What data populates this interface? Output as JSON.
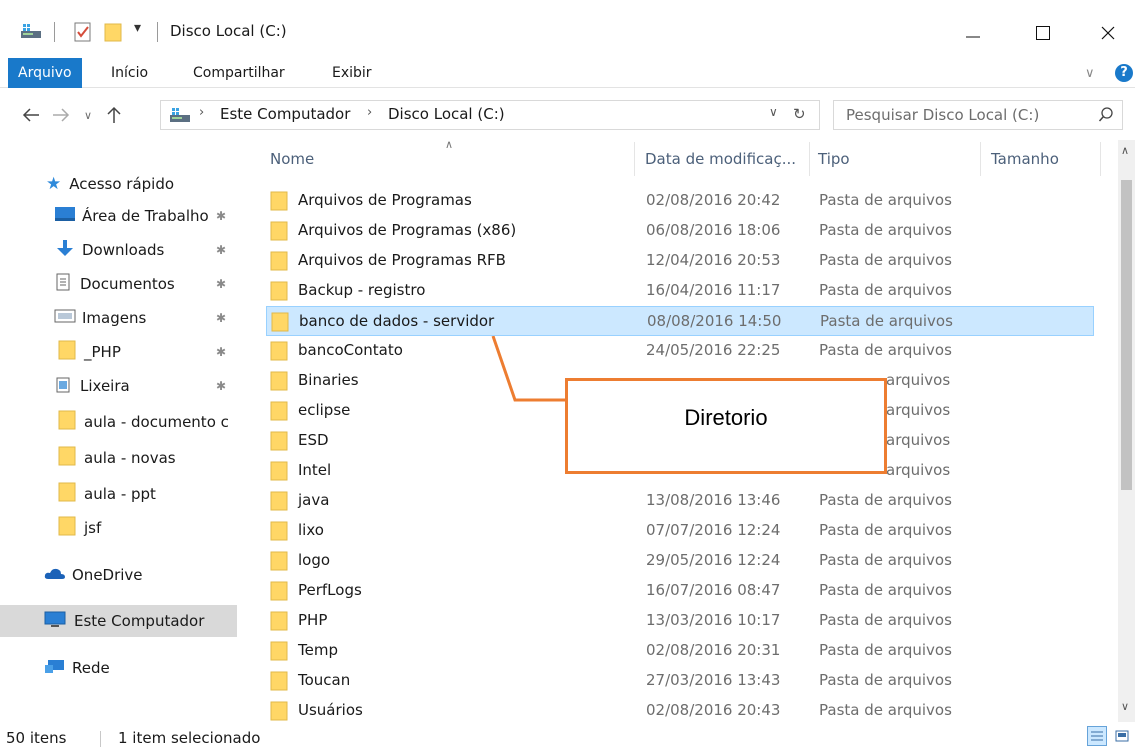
{
  "titlebar": {
    "title": "Disco Local (C:)",
    "icons": [
      "drive-icon",
      "properties-checkmark-icon",
      "new-folder-icon",
      "customize-dropdown-icon"
    ]
  },
  "ribbon": {
    "tabs": [
      {
        "label": "Arquivo",
        "active": true
      },
      {
        "label": "Início",
        "active": false
      },
      {
        "label": "Compartilhar",
        "active": false
      },
      {
        "label": "Exibir",
        "active": false
      }
    ]
  },
  "address": {
    "crumbs": [
      "Este Computador",
      "Disco Local (C:)"
    ],
    "search_placeholder": "Pesquisar Disco Local (C:)"
  },
  "sidebar": {
    "quick_access": "Acesso rápido",
    "pinned": [
      {
        "label": "Área de Trabalho",
        "icon": "desktop-icon",
        "pinned": true
      },
      {
        "label": "Downloads",
        "icon": "downloads-icon",
        "pinned": true
      },
      {
        "label": "Documentos",
        "icon": "documents-icon",
        "pinned": true
      },
      {
        "label": "Imagens",
        "icon": "pictures-icon",
        "pinned": true
      },
      {
        "label": "_PHP",
        "icon": "folder-icon",
        "pinned": true
      },
      {
        "label": "Lixeira",
        "icon": "recycle-bin-icon",
        "pinned": true
      },
      {
        "label": "aula - documento c",
        "icon": "folder-icon",
        "pinned": false
      },
      {
        "label": "aula - novas",
        "icon": "folder-icon",
        "pinned": false
      },
      {
        "label": "aula - ppt",
        "icon": "folder-icon",
        "pinned": false
      },
      {
        "label": "jsf",
        "icon": "folder-icon",
        "pinned": false
      }
    ],
    "onedrive": "OneDrive",
    "this_pc": "Este Computador",
    "network": "Rede"
  },
  "columns": {
    "name": "Nome",
    "date": "Data de modificaç...",
    "type": "Tipo",
    "size": "Tamanho"
  },
  "files": [
    {
      "name": "Arquivos de Programas",
      "date": "02/08/2016 20:42",
      "type": "Pasta de arquivos"
    },
    {
      "name": "Arquivos de Programas (x86)",
      "date": "06/08/2016 18:06",
      "type": "Pasta de arquivos"
    },
    {
      "name": "Arquivos de Programas RFB",
      "date": "12/04/2016 20:53",
      "type": "Pasta de arquivos"
    },
    {
      "name": "Backup - registro",
      "date": "16/04/2016 11:17",
      "type": "Pasta de arquivos"
    },
    {
      "name": "banco de dados - servidor",
      "date": "08/08/2016 14:50",
      "type": "Pasta de arquivos",
      "selected": true
    },
    {
      "name": "bancoContato",
      "date": "24/05/2016 22:25",
      "type": "Pasta de arquivos"
    },
    {
      "name": "Binaries",
      "date": "",
      "type": "arquivos"
    },
    {
      "name": "eclipse",
      "date": "",
      "type": "arquivos"
    },
    {
      "name": "ESD",
      "date": "",
      "type": "arquivos"
    },
    {
      "name": "Intel",
      "date": "",
      "type": "arquivos"
    },
    {
      "name": "java",
      "date": "13/08/2016 13:46",
      "type": "Pasta de arquivos"
    },
    {
      "name": "lixo",
      "date": "07/07/2016 12:24",
      "type": "Pasta de arquivos"
    },
    {
      "name": "logo",
      "date": "29/05/2016 12:24",
      "type": "Pasta de arquivos"
    },
    {
      "name": "PerfLogs",
      "date": "16/07/2016 08:47",
      "type": "Pasta de arquivos"
    },
    {
      "name": "PHP",
      "date": "13/03/2016 10:17",
      "type": "Pasta de arquivos"
    },
    {
      "name": "Temp",
      "date": "02/08/2016 20:31",
      "type": "Pasta de arquivos"
    },
    {
      "name": "Toucan",
      "date": "27/03/2016 13:43",
      "type": "Pasta de arquivos"
    },
    {
      "name": "Usuários",
      "date": "02/08/2016 20:43",
      "type": "Pasta de arquivos"
    }
  ],
  "status": {
    "count": "50 itens",
    "selection": "1 item selecionado"
  },
  "annotation": {
    "label": "Diretorio",
    "color": "#ed7d31"
  },
  "colors": {
    "accent": "#1979ca",
    "selection": "#cce8ff",
    "folder": "#ffd766"
  }
}
